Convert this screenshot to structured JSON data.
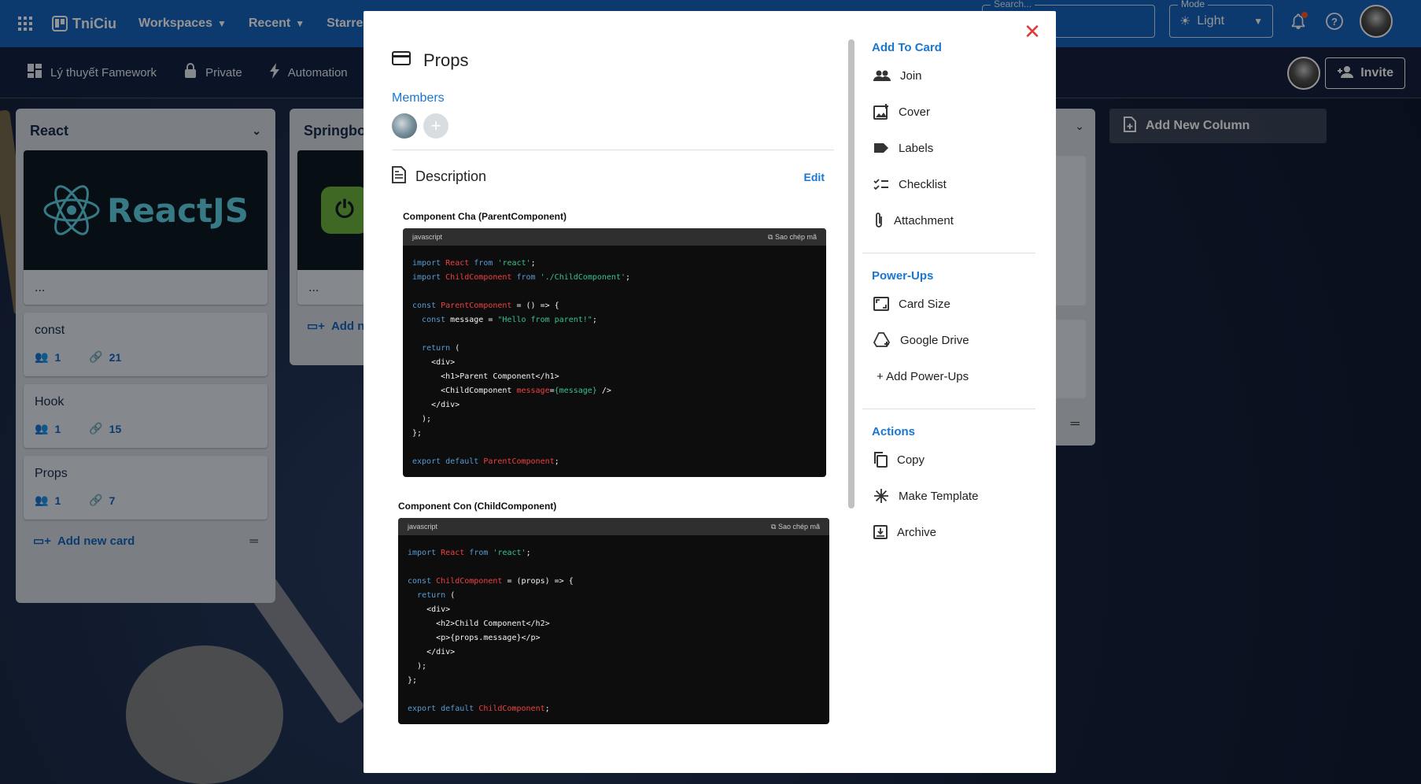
{
  "appbar": {
    "brand": "TniCiu",
    "menus": [
      "Workspaces",
      "Recent",
      "Starred"
    ],
    "search_label": "Search...",
    "mode_label": "Mode",
    "mode_value": "Light"
  },
  "boardbar": {
    "board_name": "Lý thuyết Famework",
    "visibility": "Private",
    "automation": "Automation",
    "invite": "Invite"
  },
  "columns": [
    {
      "title": "React",
      "cards": [
        {
          "cover_text": "ReactJS",
          "title": "..."
        },
        {
          "title": "const",
          "members": "1",
          "attachments": "21"
        },
        {
          "title": "Hook",
          "members": "1",
          "attachments": "15"
        },
        {
          "title": "Props",
          "members": "1",
          "attachments": "7"
        }
      ],
      "add_card": "Add new card"
    },
    {
      "title": "Springboot",
      "cards": [
        {
          "title": "..."
        }
      ],
      "add_card": "Add new card"
    }
  ],
  "add_column": "Add New Column",
  "modal": {
    "title": "Props",
    "members_label": "Members",
    "description_label": "Description",
    "edit_label": "Edit",
    "snippets": [
      {
        "caption": "Component Cha (ParentComponent)",
        "lang": "javascript",
        "copy": "Sao chép mã"
      },
      {
        "caption": "Component Con (ChildComponent)",
        "lang": "javascript",
        "copy": "Sao chép mã"
      }
    ],
    "sidebar": {
      "add_to_card": {
        "heading": "Add To Card",
        "items": [
          "Join",
          "Cover",
          "Labels",
          "Checklist",
          "Attachment"
        ]
      },
      "power_ups": {
        "heading": "Power-Ups",
        "items": [
          "Card Size",
          "Google Drive",
          "+ Add Power-Ups"
        ]
      },
      "actions": {
        "heading": "Actions",
        "items": [
          "Copy",
          "Make Template",
          "Archive"
        ]
      }
    }
  },
  "colors": {
    "appbar": "#1565c0",
    "accent": "#1976d2",
    "close": "#e53935",
    "code_keyword": "#569cd6",
    "code_identifier": "#f04040",
    "code_string": "#38c28a"
  }
}
